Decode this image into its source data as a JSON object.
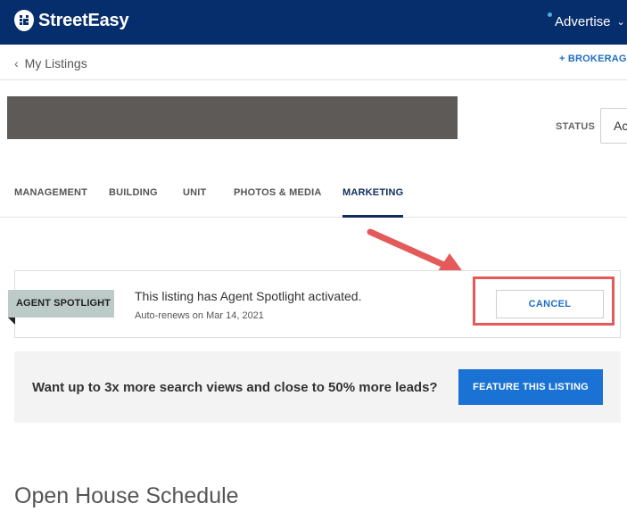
{
  "header": {
    "brand": "StreetEasy",
    "advertise_label": "Advertise",
    "colors": {
      "nav_bg": "#072e6c",
      "accent": "#1a73d4",
      "highlight": "#e45a5a"
    }
  },
  "subnav": {
    "back_label": "My Listings",
    "brokerage_label": "+ BROKERAGE"
  },
  "status": {
    "label": "STATUS",
    "value": "Ac"
  },
  "tabs": [
    {
      "label": "MANAGEMENT"
    },
    {
      "label": "BUILDING"
    },
    {
      "label": "UNIT"
    },
    {
      "label": "PHOTOS & MEDIA"
    },
    {
      "label": "MARKETING",
      "active": true
    }
  ],
  "spotlight": {
    "tag": "AGENT SPOTLIGHT",
    "message": "This listing has Agent Spotlight activated.",
    "renew": "Auto-renews on Mar 14, 2021",
    "cancel_label": "CANCEL"
  },
  "feature": {
    "prompt": "Want up to 3x more search views and close to 50% more leads?",
    "button_label": "FEATURE THIS LISTING"
  },
  "open_house": {
    "title": "Open House Schedule"
  }
}
